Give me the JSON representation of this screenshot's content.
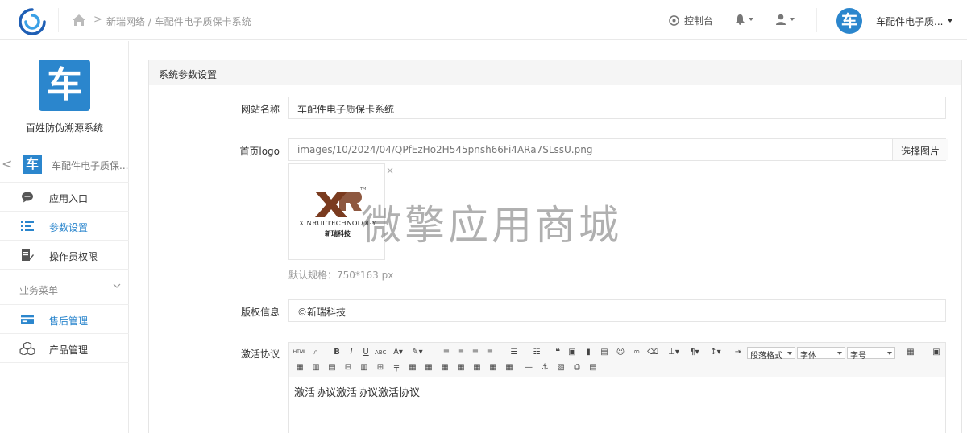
{
  "header": {
    "breadcrumb_arrow": ">",
    "breadcrumb_text": "新瑞网络 / 车配件电子质保卡系统",
    "console_label": "控制台",
    "avatar_char": "车",
    "user_name": "车配件电子质..."
  },
  "sidebar": {
    "brand_char": "车",
    "brand_name": "百姓防伪溯源系统",
    "app_switch": {
      "back": "<",
      "logo_char": "车",
      "name": "车配件电子质保..."
    },
    "items": [
      {
        "label": "应用入口",
        "icon": "chat-icon",
        "active": false
      },
      {
        "label": "参数设置",
        "icon": "list-icon",
        "active": true
      },
      {
        "label": "操作员权限",
        "icon": "edit-icon",
        "active": false
      }
    ],
    "group_title": "业务菜单",
    "group_items": [
      {
        "label": "售后管理",
        "icon": "card-icon",
        "active": true
      },
      {
        "label": "产品管理",
        "icon": "cubes-icon",
        "active": false
      }
    ]
  },
  "panel": {
    "title": "系统参数设置",
    "site_name_label": "网站名称",
    "site_name_value": "车配件电子质保卡系统",
    "logo_label": "首页logo",
    "logo_value": "images/10/2024/04/QPfEzHo2H545pnsh66Fi4ARa7SLssU.png",
    "choose_image": "选择图片",
    "thumb_close": "×",
    "logo_tm": "TM",
    "logo_en": "XINRUI TECHNOLOGY",
    "logo_cn": "新瑞科技",
    "hint": "默认规格：750*163 px",
    "copyright_label": "版权信息",
    "copyright_value": "©新瑞科技",
    "protocol_label": "激活协议",
    "editor": {
      "selects": [
        "段落格式",
        "字体",
        "字号"
      ],
      "html_btn": "HTML",
      "content": "激活协议激活协议激活协议"
    }
  },
  "watermark": "微擎应用商城",
  "colors": {
    "accent": "#2b86cd"
  }
}
